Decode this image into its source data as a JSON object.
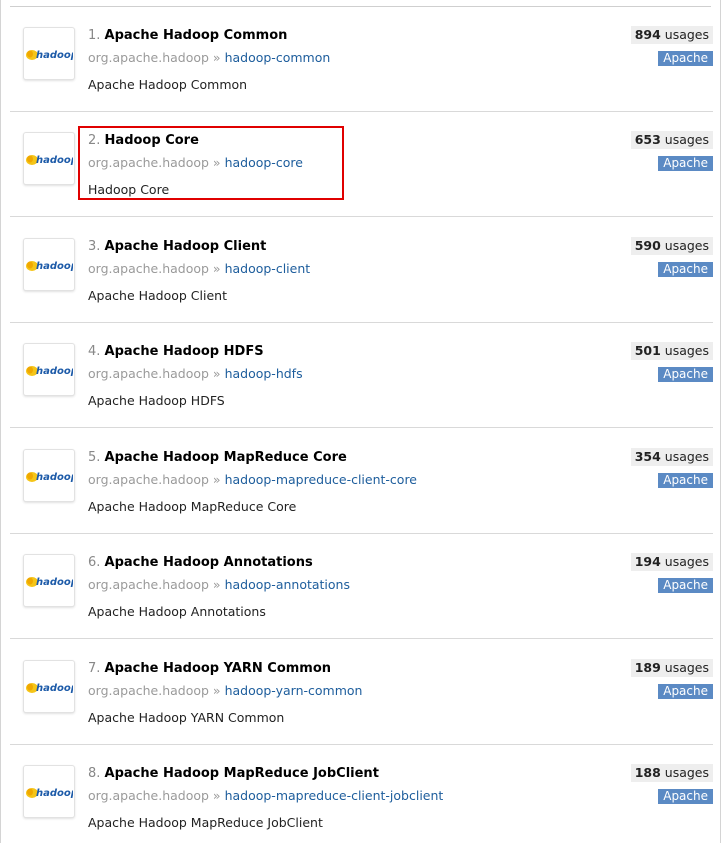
{
  "results": [
    {
      "index": "1.",
      "name": "Apache Hadoop Common",
      "group": "org.apache.hadoop",
      "separator": "»",
      "artifact": "hadoop-common",
      "description": "Apache Hadoop Common",
      "usage_count": "894",
      "usage_label": "usages",
      "license": "Apache"
    },
    {
      "index": "2.",
      "name": "Hadoop Core",
      "group": "org.apache.hadoop",
      "separator": "»",
      "artifact": "hadoop-core",
      "description": "Hadoop Core",
      "usage_count": "653",
      "usage_label": "usages",
      "license": "Apache"
    },
    {
      "index": "3.",
      "name": "Apache Hadoop Client",
      "group": "org.apache.hadoop",
      "separator": "»",
      "artifact": "hadoop-client",
      "description": "Apache Hadoop Client",
      "usage_count": "590",
      "usage_label": "usages",
      "license": "Apache"
    },
    {
      "index": "4.",
      "name": "Apache Hadoop HDFS",
      "group": "org.apache.hadoop",
      "separator": "»",
      "artifact": "hadoop-hdfs",
      "description": "Apache Hadoop HDFS",
      "usage_count": "501",
      "usage_label": "usages",
      "license": "Apache"
    },
    {
      "index": "5.",
      "name": "Apache Hadoop MapReduce Core",
      "group": "org.apache.hadoop",
      "separator": "»",
      "artifact": "hadoop-mapreduce-client-core",
      "description": "Apache Hadoop MapReduce Core",
      "usage_count": "354",
      "usage_label": "usages",
      "license": "Apache"
    },
    {
      "index": "6.",
      "name": "Apache Hadoop Annotations",
      "group": "org.apache.hadoop",
      "separator": "»",
      "artifact": "hadoop-annotations",
      "description": "Apache Hadoop Annotations",
      "usage_count": "194",
      "usage_label": "usages",
      "license": "Apache"
    },
    {
      "index": "7.",
      "name": "Apache Hadoop YARN Common",
      "group": "org.apache.hadoop",
      "separator": "»",
      "artifact": "hadoop-yarn-common",
      "description": "Apache Hadoop YARN Common",
      "usage_count": "189",
      "usage_label": "usages",
      "license": "Apache"
    },
    {
      "index": "8.",
      "name": "Apache Hadoop MapReduce JobClient",
      "group": "org.apache.hadoop",
      "separator": "»",
      "artifact": "hadoop-mapreduce-client-jobclient",
      "description": "Apache Hadoop MapReduce JobClient",
      "usage_count": "188",
      "usage_label": "usages",
      "license": "Apache"
    }
  ],
  "logo": {
    "text": "hadoop",
    "icon": "hadoop-elephant-logo",
    "text_color": "#1c5aa8",
    "elephant_color": "#f5c518"
  },
  "colors": {
    "highlight": "#e00000",
    "license_badge": "#5b8ac4",
    "link": "#1d5d9c",
    "usage_badge_bg": "#eeeeee"
  },
  "highlight": {
    "row_index": 1
  }
}
